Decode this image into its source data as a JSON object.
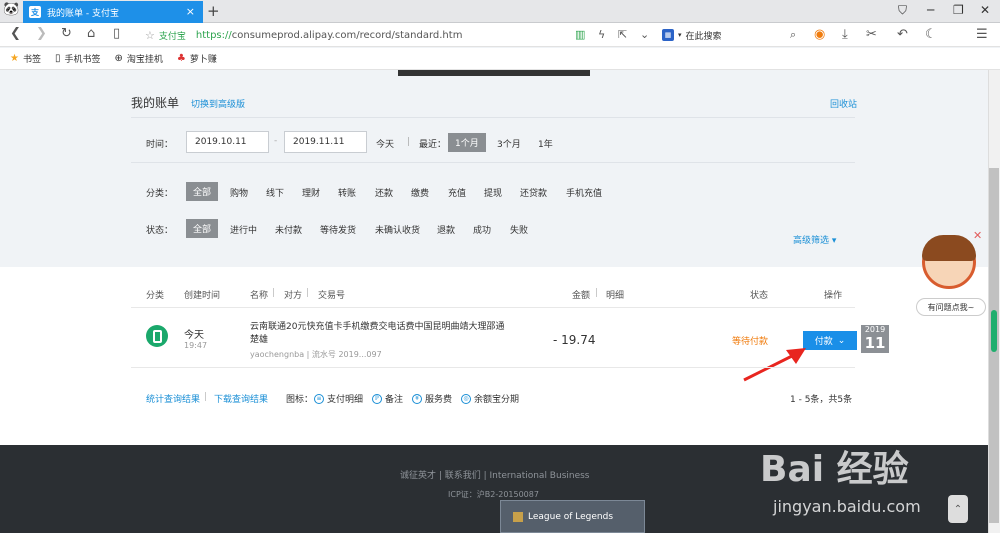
{
  "browser": {
    "tab_title": "我的账单 - 支付宝",
    "tab_icon_char": "支",
    "new_tab": "+",
    "secure_label": "支付宝",
    "url_https": "https://",
    "url_domain": "consumeprod.alipay.com",
    "url_path": "/record/standard.htm",
    "search_placeholder": "在此搜索"
  },
  "bookmarks": [
    {
      "label": "书签",
      "icon": "star-icon"
    },
    {
      "label": "手机书签",
      "icon": "phone-icon"
    },
    {
      "label": "淘宝挂机",
      "icon": "globe-icon"
    },
    {
      "label": "萝卜赚",
      "icon": "radish-icon"
    }
  ],
  "page": {
    "title": "我的账单",
    "switch_link": "切换到高级版",
    "recycle": "回收站",
    "time_label": "时间：",
    "date_from": "2019.10.11",
    "date_sep": "-",
    "date_to": "2019.11.11",
    "quick_today": "今天",
    "recent_label": "最近：",
    "quick_ranges": [
      "1个月",
      "3个月",
      "1年"
    ],
    "category_label": "分类：",
    "categories": [
      "全部",
      "购物",
      "线下",
      "理财",
      "转账",
      "还款",
      "缴费",
      "充值",
      "提现",
      "还贷款",
      "手机充值"
    ],
    "status_label": "状态：",
    "statuses": [
      "全部",
      "进行中",
      "未付款",
      "等待发货",
      "未确认收货",
      "退款",
      "成功",
      "失败"
    ],
    "advanced_filter": "高级筛选"
  },
  "table": {
    "headers": {
      "category": "分类",
      "created": "创建时间",
      "name": "名称",
      "counterparty": "对方",
      "txn": "交易号",
      "amount": "金额",
      "detail": "明细",
      "status": "状态",
      "action": "操作"
    },
    "rows": [
      {
        "day": "今天",
        "time": "19:47",
        "name": "云南联通20元快充值卡手机缴费交电话费中国昆明曲靖大理邵通楚雄",
        "sub": "yaochengnba | 流水号 2019...097",
        "amount": "- 19.74",
        "status": "等待付款",
        "action": "付款",
        "year": "2019",
        "date_day": "11"
      }
    ]
  },
  "table_footer": {
    "stats_link": "统计查询结果",
    "download_link": "下载查询结果",
    "legend_label": "图标：",
    "legend": [
      {
        "label": "支付明细",
        "icon": "detail-icon"
      },
      {
        "label": "备注",
        "icon": "note-icon"
      },
      {
        "label": "服务费",
        "icon": "fee-icon"
      },
      {
        "label": "余额宝分期",
        "icon": "installment-icon"
      }
    ],
    "pager": "1 - 5条，共5条"
  },
  "footer": {
    "links": "诚征英才 | 联系我们 | International Business",
    "icp": "ICP证：沪B2-20150087"
  },
  "popup": {
    "lol": "League of Legends",
    "helper_bubble": "有问题点我~"
  },
  "watermark": {
    "brand": "Bai 经验",
    "url": "jingyan.baidu.com"
  },
  "colors": {
    "accent": "#1a8fd6",
    "pay_button": "#1a8fe8",
    "status_pending": "#f07c0e",
    "selected_option": "#8a8e92",
    "footer_bg": "#2b2f33"
  }
}
